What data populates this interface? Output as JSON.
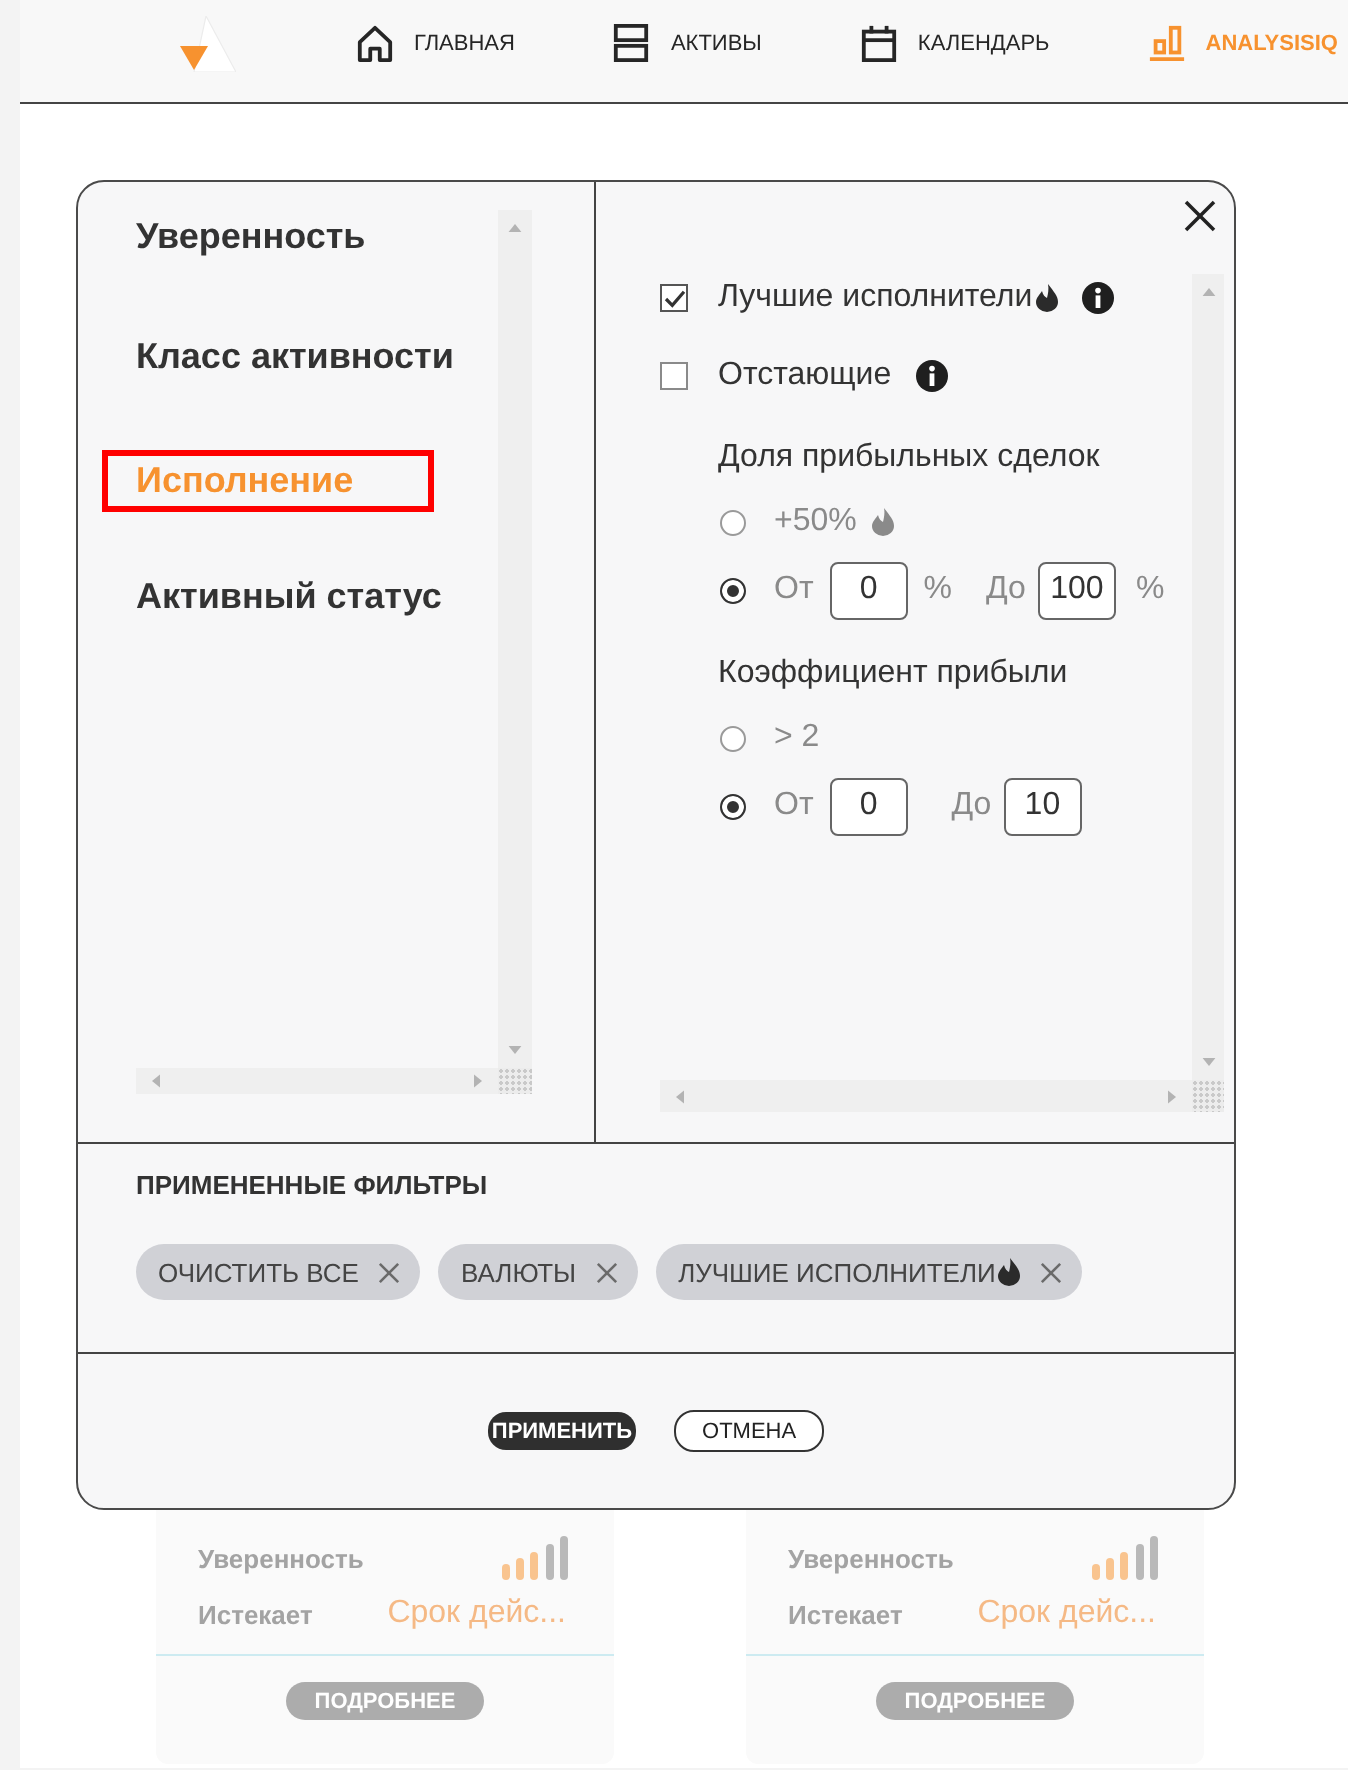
{
  "nav": {
    "items": [
      {
        "kind": "home",
        "label": "ГЛАВНАЯ",
        "selected": false
      },
      {
        "kind": "assets",
        "label": "АКТИВЫ",
        "selected": false
      },
      {
        "kind": "calendar",
        "label": "КАЛЕНДАРЬ",
        "selected": false
      },
      {
        "kind": "analysis",
        "label": "ANALYSISIQ",
        "selected": true
      }
    ]
  },
  "filter_dialog": {
    "categories": [
      {
        "label": "Уверенность",
        "selected": false,
        "highlighted": false
      },
      {
        "label": "Класс активности",
        "selected": false,
        "highlighted": false
      },
      {
        "label": "Исполнение",
        "selected": true,
        "highlighted": true
      },
      {
        "label": "Активный статус",
        "selected": false,
        "highlighted": false
      }
    ],
    "options": [
      {
        "kind": "checkbox",
        "label": "Лучшие исполнители",
        "checked": true,
        "hot": true,
        "info": true
      },
      {
        "kind": "checkbox",
        "label": "Отстающие",
        "checked": false,
        "info": true
      }
    ],
    "groups": [
      {
        "title": "Доля прибыльных сделок",
        "choices": [
          {
            "kind": "preset",
            "label": "+50%",
            "hot": true,
            "selected": false
          },
          {
            "kind": "range",
            "selected": true,
            "from": {
              "label": "От",
              "value": "0",
              "unit": "%"
            },
            "to": {
              "label": "До",
              "value": "100",
              "unit": "%"
            }
          }
        ]
      },
      {
        "title": "Коэффициент прибыли",
        "choices": [
          {
            "kind": "preset",
            "label": "> 2",
            "selected": false
          },
          {
            "kind": "range",
            "selected": true,
            "from": {
              "label": "От",
              "value": "0"
            },
            "to": {
              "label": "До",
              "value": "10"
            }
          }
        ]
      }
    ],
    "applied_filters": {
      "title": "ПРИМЕНЕННЫЕ ФИЛЬТРЫ",
      "chips": [
        {
          "label": "ОЧИСТИТЬ ВСЕ"
        },
        {
          "label": "ВАЛЮТЫ"
        },
        {
          "label": "ЛУЧШИЕ ИСПОЛНИТЕЛИ",
          "hot": true
        }
      ]
    },
    "buttons": [
      {
        "kind": "primary",
        "label": "ПРИМЕНИТЬ"
      },
      {
        "kind": "secondary",
        "label": "ОТМЕНА"
      }
    ]
  },
  "asset_cards": [
    {
      "rows": [
        {
          "kind": "signal",
          "label": "Уверенность"
        },
        {
          "kind": "text",
          "label": "Истекает",
          "value": "Срок дейс..."
        }
      ],
      "button": "ПОДРОБНЕЕ"
    },
    {
      "rows": [
        {
          "kind": "signal",
          "label": "Уверенность"
        },
        {
          "kind": "text",
          "label": "Истекает",
          "value": "Срок дейс..."
        }
      ],
      "button": "ПОДРОБНЕЕ"
    }
  ]
}
